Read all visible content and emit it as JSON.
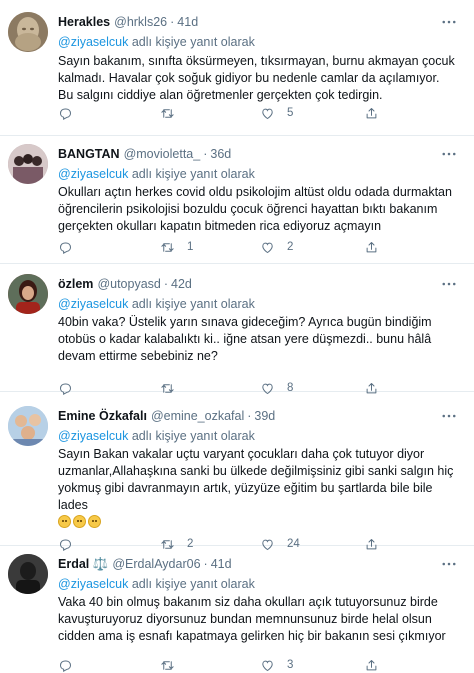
{
  "tweets": [
    {
      "name": "Herakles",
      "handle": "@hrkls26",
      "time": "41d",
      "reply_prefix": "@ziyaselcuk",
      "reply_suffix": "adlı kişiye yanıt olarak",
      "text": "Sayın bakanım, sınıfta öksürmeyen, tıksırmayan, burnu akmayan çocuk kalmadı. Havalar çok soğuk gidiyor bu nedenle camlar da açılamıyor. Bu salgını ciddiye alan öğretmenler gerçekten çok tedirgin.",
      "emojis": 0,
      "replies": "",
      "retweets": "",
      "likes": "5",
      "avatar": "statue"
    },
    {
      "name": "BANGTAN",
      "handle": "@movioletta_",
      "time": "36d",
      "reply_prefix": "@ziyaselcuk",
      "reply_suffix": "adlı kişiye yanıt olarak",
      "text": "Okulları açtın herkes covid oldu psikolojim altüst oldu odada durmaktan öğrencilerin psikolojisi bozuldu çocuk öğrenci hayattan bıktı  bakanım gerçekten okulları kapatın bitmeden rica ediyoruz açmayın",
      "emojis": 0,
      "replies": "",
      "retweets": "1",
      "likes": "2",
      "avatar": "group"
    },
    {
      "name": "özlem",
      "handle": "@utopyasd",
      "time": "42d",
      "reply_prefix": "@ziyaselcuk",
      "reply_suffix": "adlı kişiye yanıt olarak",
      "text": "40bin vaka? Üstelik yarın sınava gideceğim? Ayrıca bugün bindiğim otobüs o kadar kalabalıktı ki.. iğne atsan yere düşmezdi.. bunu hâlâ devam ettirme sebebiniz ne?",
      "emojis": 0,
      "replies": "",
      "retweets": "",
      "likes": "8",
      "avatar": "woman"
    },
    {
      "name": "Emine Özkafalı",
      "handle": "@emine_ozkafal",
      "time": "39d",
      "reply_prefix": "@ziyaselcuk",
      "reply_suffix": "adlı kişiye yanıt olarak",
      "text": "Sayın Bakan vakalar uçtu varyant çocukları daha çok tutuyor diyor uzmanlar,Allahaşkına sanki bu ülkede değilmişsiniz gibi sanki salgın hiç yokmuş gibi davranmayın artık, yüzyüze eğitim bu şartlarda bile bile lades",
      "emojis": 3,
      "replies": "",
      "retweets": "2",
      "likes": "24",
      "avatar": "family"
    },
    {
      "name": "Erdal",
      "name_badge": "⚖️",
      "handle": "@ErdalAydar06",
      "time": "41d",
      "reply_prefix": "@ziyaselcuk",
      "reply_suffix": "adlı kişiye yanıt olarak",
      "text": "Vaka 40 bin olmuş bakanım siz daha okulları açık tutuyorsunuz birde kavuşturuyoruz diyorsunuz bundan memnunsunuz birde helal olsun cidden ama iş esnafı kapatmaya gelirken hiç bir bakanın sesi çıkmıyor",
      "emojis": 0,
      "replies": "",
      "retweets": "",
      "likes": "3",
      "avatar": "dark"
    }
  ],
  "icons": {
    "reply": "reply-icon",
    "retweet": "retweet-icon",
    "like": "heart-icon",
    "share": "share-icon",
    "more": "more-icon"
  },
  "colors": {
    "text": "#0f1419",
    "secondary": "#5b7083",
    "mention": "#1b95e0",
    "divider": "#e6ecf0"
  }
}
